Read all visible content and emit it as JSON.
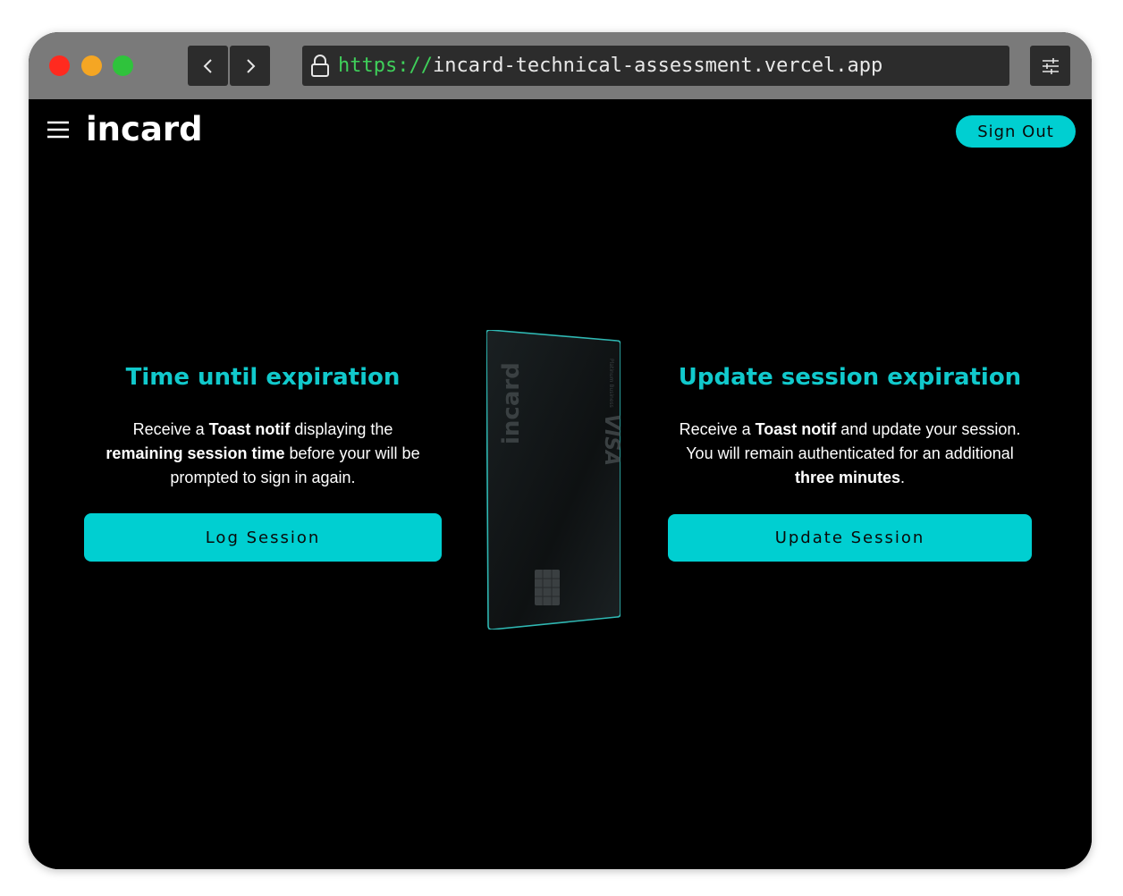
{
  "browser": {
    "url_scheme": "https://",
    "url_host": "incard-technical-assessment.vercel.app"
  },
  "header": {
    "logo_text": "incard",
    "sign_out_label": "Sign Out"
  },
  "left_panel": {
    "title": "Time until expiration",
    "desc": {
      "l1_pre": "Receive a ",
      "l1_bold": "Toast notif",
      "l1_post": " displaying the",
      "l2_bold": "remaining session time",
      "l2_post": " before your will be",
      "l3": "prompted to sign in again."
    },
    "button_label": "Log Session"
  },
  "right_panel": {
    "title": "Update session expiration",
    "desc": {
      "l1_pre": "Receive a ",
      "l1_bold": "Toast notif",
      "l1_post": " and update your session.",
      "l2": "You will remain authenticated for an additional",
      "l3_bold": "three minutes",
      "l3_post": "."
    },
    "button_label": "Update Session"
  },
  "card": {
    "brand": "incard",
    "network": "VISA",
    "tier": "Platinum Business"
  },
  "colors": {
    "accent": "#00cfd1",
    "heading": "#11c9cc",
    "background": "#000000",
    "chrome": "#7a7a7a"
  }
}
